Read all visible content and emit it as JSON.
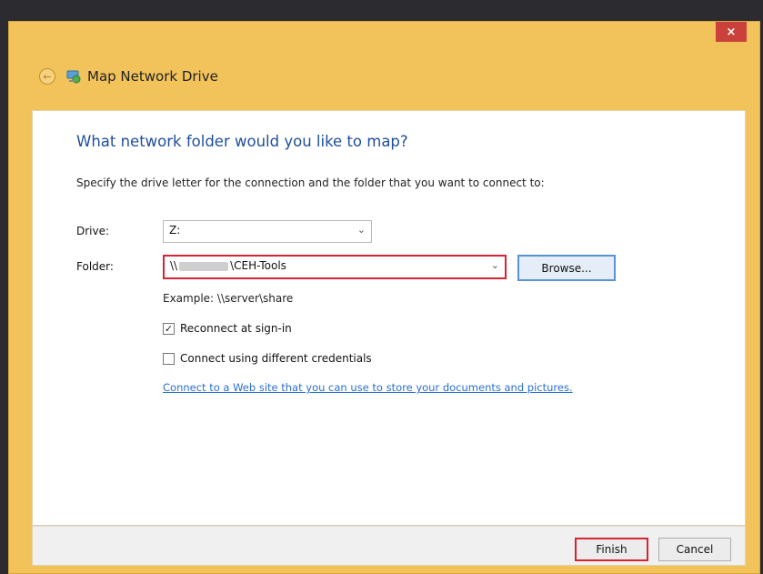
{
  "window": {
    "title": "Map Network Drive",
    "close_label": "×"
  },
  "icons": {
    "back": "back-arrow-icon",
    "app": "network-drive-icon",
    "check": "checkmark-icon"
  },
  "colors": {
    "frame": "#f2c35a",
    "heading": "#1f4e9c",
    "highlight": "#d62433",
    "link": "#2a6fd1",
    "close": "#c9413a"
  },
  "dialog": {
    "heading": "What network folder would you like to map?",
    "description": "Specify the drive letter for the connection and the folder that you want to connect to:",
    "drive": {
      "label": "Drive:",
      "value": "Z:"
    },
    "folder": {
      "label": "Folder:",
      "value_prefix": "\\\\",
      "value_suffix": "\\CEH-Tools"
    },
    "browse_label": "Browse...",
    "example": "Example: \\\\server\\share",
    "reconnect": {
      "label": "Reconnect at sign-in",
      "checked": true
    },
    "credentials": {
      "label": "Connect using different credentials",
      "checked": false
    },
    "link": "Connect to a Web site that you can use to store your documents and pictures."
  },
  "footer": {
    "finish_label": "Finish",
    "cancel_label": "Cancel"
  }
}
